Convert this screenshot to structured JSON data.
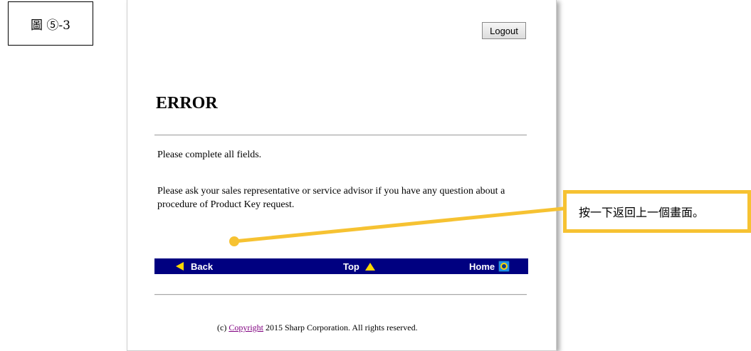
{
  "figure_label": "圖 ⑤-3",
  "page": {
    "logout_label": "Logout",
    "title": "ERROR",
    "message_1": "Please complete all fields.",
    "message_2": "Please ask your sales representative or service advisor if you have any question about a procedure of Product Key request.",
    "nav": {
      "back_label": "Back",
      "top_label": "Top",
      "home_label": "Home"
    },
    "footer": {
      "prefix": "(c)",
      "link_text": "Copyright",
      "suffix": "2015 Sharp Corporation. All rights reserved."
    }
  },
  "annotation": {
    "callout_text": "按一下返回上一個畫面。",
    "color": "#f6c232"
  },
  "colors": {
    "navbar_bg": "#000080",
    "nav_arrow": "#ffd800",
    "link_visited": "#800080"
  }
}
